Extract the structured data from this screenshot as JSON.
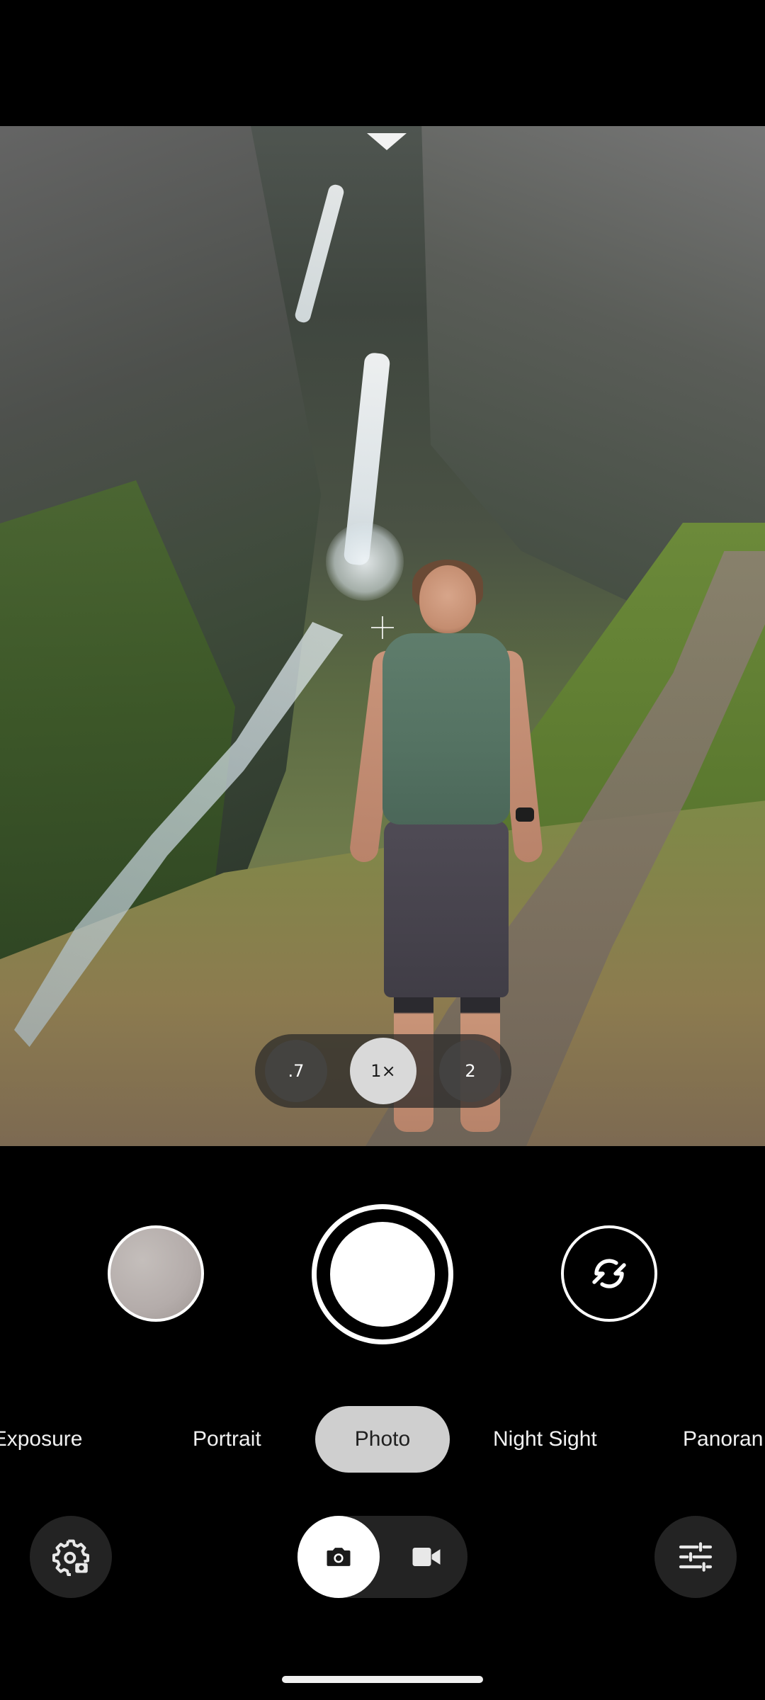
{
  "zoom": {
    "options": [
      ".7",
      "1×",
      "2"
    ],
    "selected": "1×"
  },
  "modes": {
    "items": [
      "Long Exposure",
      "Portrait",
      "Photo",
      "Night Sight",
      "Panorama"
    ],
    "selected": "Photo",
    "visible_text": [
      "ng Exposure",
      "Portrait",
      "Photo",
      "Night Sight",
      "Panoran"
    ]
  },
  "capture": {
    "type_selected": "photo",
    "types": [
      "photo",
      "video"
    ]
  },
  "icons": {
    "thumbnail": "last-photo-thumbnail",
    "shutter": "shutter-icon",
    "flip": "switch-camera-icon",
    "settings": "camera-settings-gear-icon",
    "tune": "tune-sliders-icon",
    "photo": "camera-icon",
    "video": "video-camera-icon"
  },
  "colors": {
    "background": "#000000",
    "mode_selected_bg": "#cfcfcf",
    "zoom_selected_bg": "#d9d9d9"
  }
}
